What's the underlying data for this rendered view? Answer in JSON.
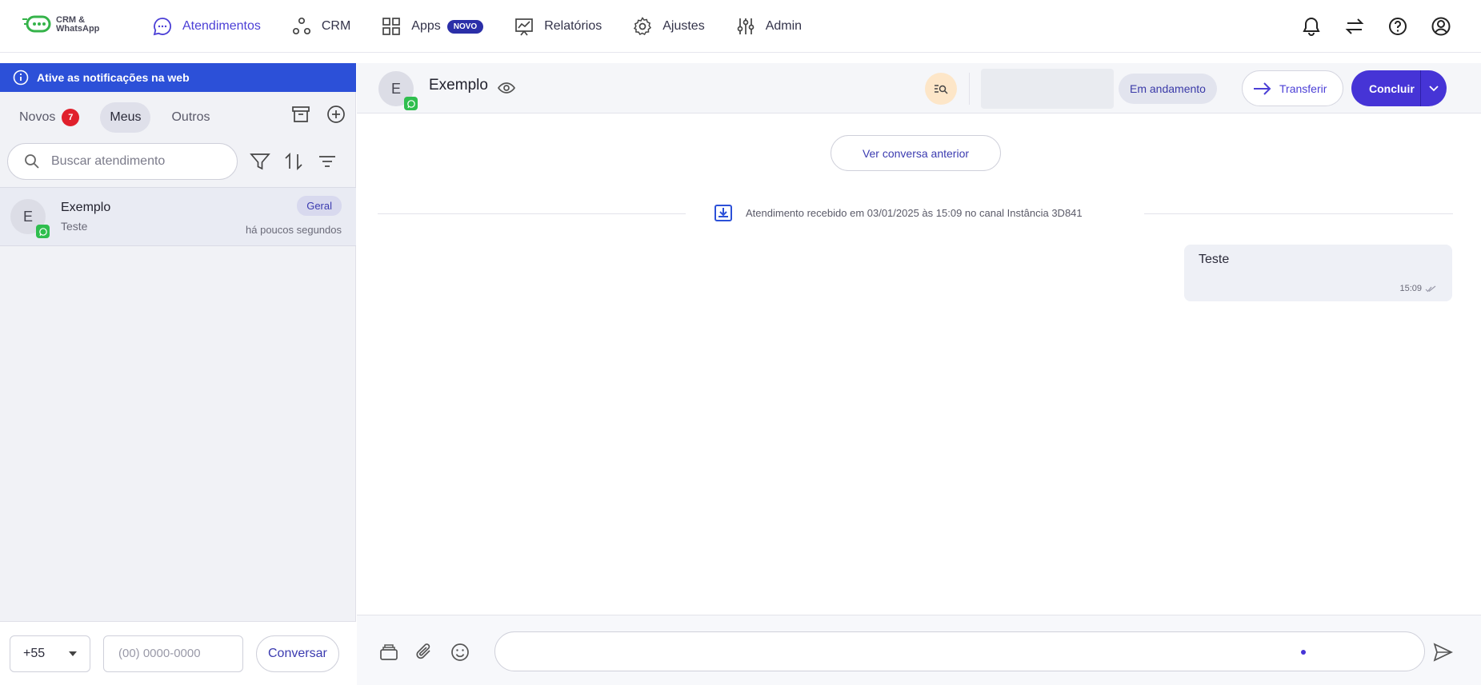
{
  "app": {
    "logo_line1": "CRM &",
    "logo_line2": "WhatsApp"
  },
  "nav": {
    "items": [
      {
        "label": "Atendimentos",
        "active": true,
        "icon": "chat-bubble-icon"
      },
      {
        "label": "CRM",
        "active": false,
        "icon": "crm-nodes-icon"
      },
      {
        "label": "Apps",
        "active": false,
        "icon": "apps-grid-icon",
        "badge": "NOVO"
      },
      {
        "label": "Relatórios",
        "active": false,
        "icon": "report-chart-icon"
      },
      {
        "label": "Ajustes",
        "active": false,
        "icon": "gear-icon"
      },
      {
        "label": "Admin",
        "active": false,
        "icon": "sliders-icon"
      }
    ],
    "right_icons": [
      "bell-icon",
      "swap-arrows-icon",
      "help-icon",
      "user-circle-icon"
    ]
  },
  "notice": {
    "text": "Ative as notificações na web"
  },
  "tabs": {
    "novos": "Novos",
    "novos_count": "7",
    "meus": "Meus",
    "outros": "Outros",
    "active": "Meus"
  },
  "search": {
    "placeholder": "Buscar atendimento"
  },
  "conversations": [
    {
      "initial": "E",
      "name": "Exemplo",
      "last_message": "Teste",
      "tag": "Geral",
      "time": "há poucos segundos",
      "channel": "whatsapp"
    }
  ],
  "footer": {
    "ddi": "+55",
    "phone_placeholder": "(00) 0000-0000",
    "button": "Conversar"
  },
  "chat": {
    "initial": "E",
    "contact_name": "Exemplo",
    "status": "Em andamento",
    "transfer_label": "Transferir",
    "conclude_label": "Concluir",
    "previous_button": "Ver conversa anterior",
    "system_message": "Atendimento recebido em 03/01/2025 às 15:09 no canal Instância 3D841",
    "messages": [
      {
        "text": "Teste",
        "time": "15:09",
        "outgoing": true
      }
    ]
  },
  "colors": {
    "accent": "#4634d6",
    "notice_bg": "#2c50d8",
    "badge_red": "#e0202c",
    "whatsapp_green": "#2fbe4e"
  }
}
